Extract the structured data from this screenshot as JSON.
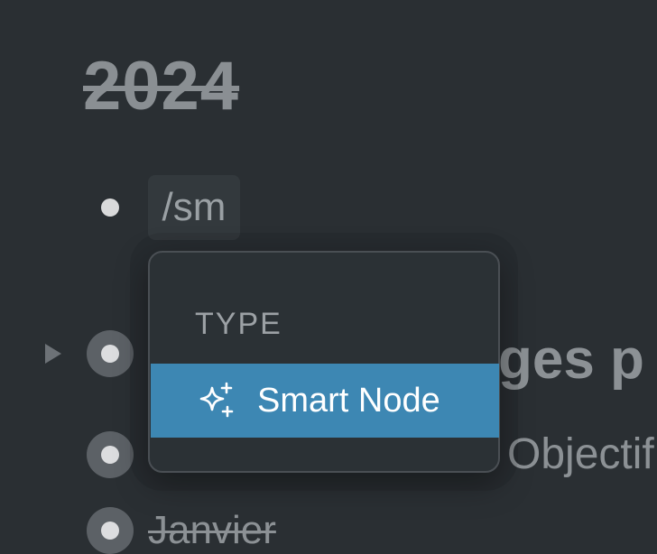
{
  "page": {
    "title": "2024"
  },
  "editor": {
    "command_text": "/sm",
    "heading_fragment": "ges p",
    "objective_fragment": "Objectif",
    "struck_item": "Janvier"
  },
  "dropdown": {
    "section_label": "TYPE",
    "items": [
      {
        "label": "Smart Node",
        "icon": "sparkles-icon",
        "selected": true
      }
    ]
  },
  "colors": {
    "background": "#2a2f33",
    "accent": "#3d87b3",
    "muted_text": "#8c9195"
  }
}
